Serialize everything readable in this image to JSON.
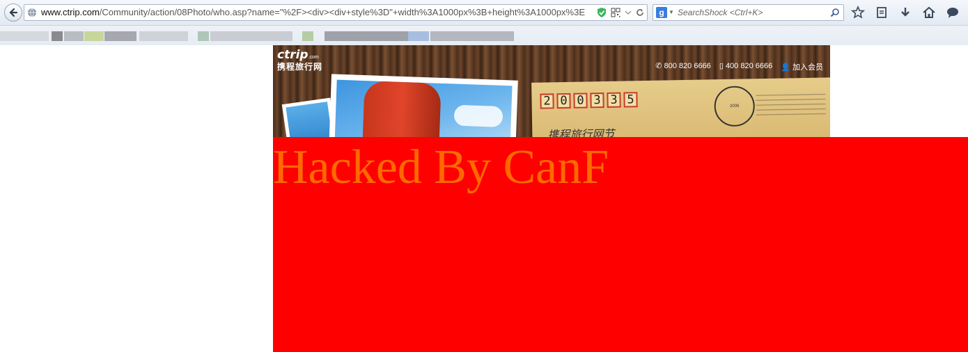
{
  "browser": {
    "url_host": "www.ctrip.com",
    "url_path": "/Community/action/08Photo/who.asp?name=\"%2F><div><div+style%3D\"+width%3A1000px%3B+height%3A1000px%3E",
    "search_placeholder": "SearchShock <Ctrl+K>",
    "search_engine_icon": "g-icon",
    "toolbar_icons": [
      "star-icon",
      "reading-list-icon",
      "download-icon",
      "home-icon",
      "chat-icon"
    ]
  },
  "banner": {
    "logo_text": "ctrip",
    "logo_suffix": ".com",
    "logo_cn": "携程旅行网",
    "phone1": "800 820 6666",
    "phone2": "400 820 6666",
    "member_link": "加入会员",
    "postcode_digits": [
      "2",
      "0",
      "0",
      "3",
      "3",
      "5"
    ],
    "stamp_text": "2006",
    "handwriting": "携程旅行网节"
  },
  "hack": {
    "text": "Hacked By CanF",
    "background": "#ff0000",
    "color": "#ff6a00"
  }
}
